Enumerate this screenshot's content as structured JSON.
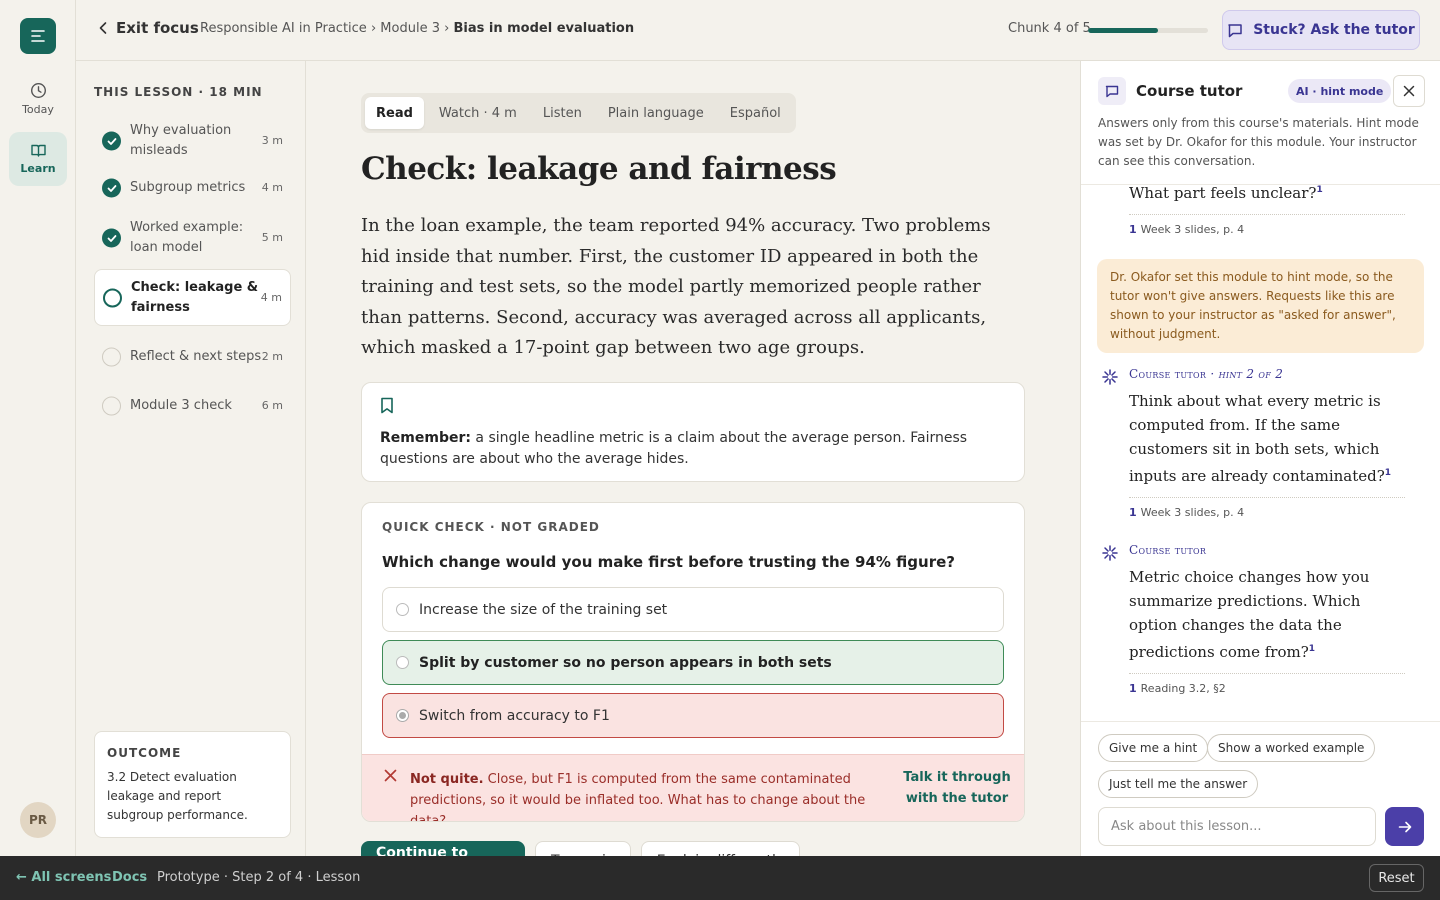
{
  "rail": {
    "items": [
      {
        "label": "Today",
        "icon": "clock-icon"
      },
      {
        "label": "Learn",
        "icon": "book-icon"
      }
    ],
    "avatar": "PR"
  },
  "topbar": {
    "exit_label": "Exit focus",
    "breadcrumb": [
      "Responsible AI in Practice",
      "Module 3",
      "Bias in model evaluation"
    ],
    "breadcrumb_sep": "›",
    "chunk_label": "Chunk 4 of 5",
    "progress": 0.58,
    "stuck_label": "Stuck? Ask the tutor"
  },
  "lesson": {
    "title": "THIS LESSON · 18 MIN",
    "items": [
      {
        "name": "Why evaluation misleads",
        "duration": "3 m",
        "status": "done"
      },
      {
        "name": "Subgroup metrics",
        "duration": "4 m",
        "status": "done"
      },
      {
        "name": "Worked example: loan model",
        "duration": "5 m",
        "status": "done"
      },
      {
        "name": "Check: leakage & fairness",
        "duration": "4 m",
        "status": "current"
      },
      {
        "name": "Reflect & next steps",
        "duration": "2 m",
        "status": "todo"
      },
      {
        "name": "Module 3 check",
        "duration": "6 m",
        "status": "todo"
      }
    ],
    "outcome_label": "OUTCOME",
    "outcome_text": "3.2 Detect evaluation leakage and report subgroup performance."
  },
  "main": {
    "tabs": [
      "Read",
      "Watch · 4 m",
      "Listen",
      "Plain language",
      "Español"
    ],
    "active_tab": 0,
    "title": "Check: leakage and fairness",
    "body": "In the loan example, the team reported 94% accuracy. Two problems hid inside that number. First, the customer ID appeared in both the training and test sets, so the model partly memorized people rather than patterns. Second, accuracy was averaged across all applicants, which masked a 17-point gap between two age groups.",
    "remember_label": "Remember:",
    "remember_text": " a single headline metric is a claim about the average person. Fairness questions are about who the average hides.",
    "quiz": {
      "label": "QUICK CHECK · NOT GRADED",
      "question": "Which change would you make first before trusting the 94% figure?",
      "options": [
        {
          "text": "Increase the size of the training set",
          "state": "neutral"
        },
        {
          "text": "Split by customer so no person appears in both sets",
          "state": "correct"
        },
        {
          "text": "Switch from accuracy to F1",
          "state": "wrong"
        }
      ],
      "feedback_title": "Not quite.",
      "feedback_text": " Close, but F1 is computed from the same contaminated predictions, so it would be inflated too. What has to change about the data?",
      "talk_link": "Talk it through with the tutor"
    },
    "buttons": {
      "continue": "Continue to Reflect",
      "try_again": "Try again",
      "explain": "Explain differently"
    }
  },
  "tutor": {
    "title": "Course tutor",
    "badge": "AI · hint mode",
    "description": "Answers only from this course's materials. Hint mode was set by Dr. Okafor for this module. Your instructor can see this conversation.",
    "messages": [
      {
        "text": "What part feels unclear?",
        "cite_num": "1",
        "cite": "Week 3 slides, p. 4"
      },
      {
        "speaker": "Course tutor",
        "meta": " · hint 2 of 2",
        "text": "Think about what every metric is computed from. If the same customers sit in both sets, which inputs are already contaminated?",
        "cite_num": "1",
        "cite": "Week 3 slides, p. 4"
      },
      {
        "speaker": "Course tutor",
        "meta": "",
        "text": "Metric choice changes how you summarize predictions. Which option changes the data the predictions come from?",
        "cite_num": "1",
        "cite": "Reading 3.2, §2"
      }
    ],
    "warning": "Dr. Okafor set this module to hint mode, so the tutor won't give answers. Requests like this are shown to your instructor as \"asked for answer\", without judgment.",
    "chips": [
      "Give me a hint",
      "Show a worked example",
      "Just tell me the answer"
    ],
    "input_placeholder": "Ask about this lesson..."
  },
  "footer": {
    "all_screens": "← All screens",
    "docs": "Docs",
    "status": "Prototype · Step 2 of 4 · Lesson",
    "reset": "Reset"
  },
  "colors": {
    "accent": "#17665a",
    "tutor_accent": "#3a3592",
    "correct_bg": "#e6f1e8",
    "wrong_bg": "#fae3e1",
    "warn_bg": "#fbecd6"
  }
}
